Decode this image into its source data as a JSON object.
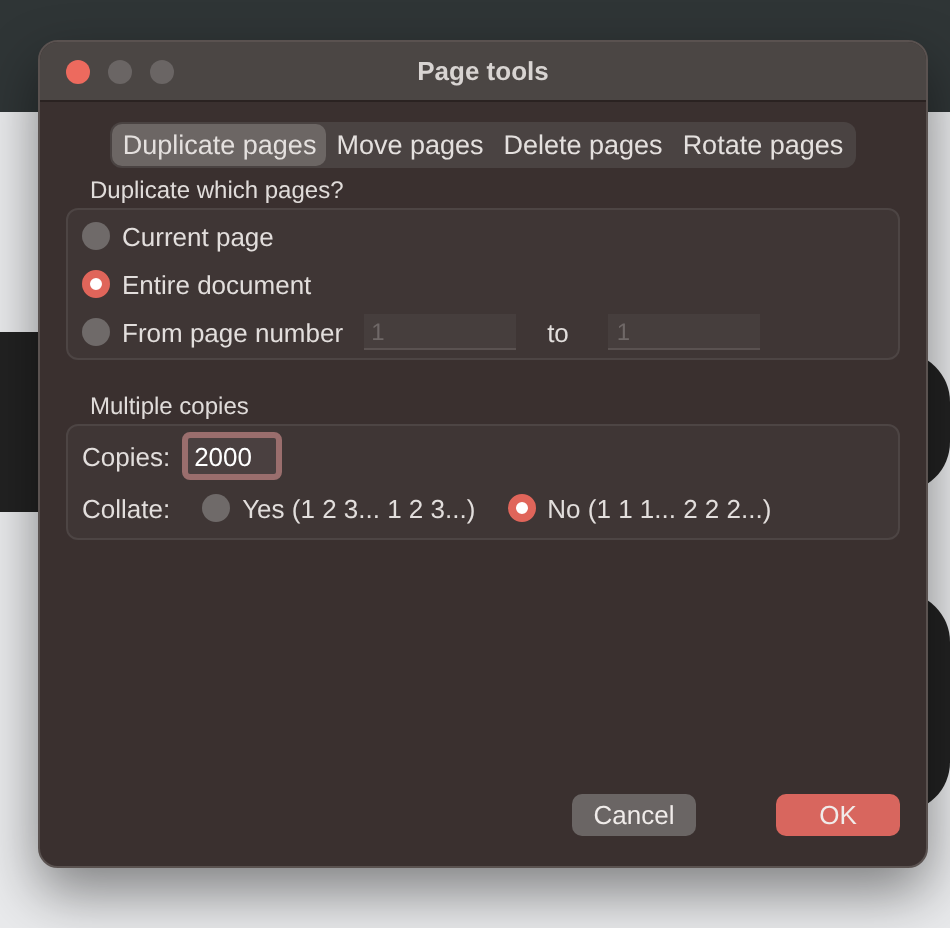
{
  "window": {
    "title": "Page tools"
  },
  "tabs": [
    {
      "label": "Duplicate pages",
      "selected": true
    },
    {
      "label": "Move pages",
      "selected": false
    },
    {
      "label": "Delete pages",
      "selected": false
    },
    {
      "label": "Rotate pages",
      "selected": false
    }
  ],
  "pages_group": {
    "title": "Duplicate which pages?",
    "options": [
      {
        "label": "Current page",
        "selected": false
      },
      {
        "label": "Entire document",
        "selected": true
      },
      {
        "label": "From page number",
        "selected": false,
        "from": {
          "placeholder": "1"
        },
        "to_label": "to",
        "to": {
          "placeholder": "1"
        }
      }
    ]
  },
  "copies_group": {
    "title": "Multiple copies",
    "copies_label": "Copies:",
    "copies_value": "2000",
    "collate_label": "Collate:",
    "collate_options": [
      {
        "label": "Yes (1 2 3... 1 2 3...)",
        "selected": false
      },
      {
        "label": "No (1 1 1... 2 2 2...)",
        "selected": true
      }
    ]
  },
  "buttons": [
    {
      "label": "Cancel",
      "kind": "secondary"
    },
    {
      "label": "OK",
      "kind": "primary"
    }
  ]
}
